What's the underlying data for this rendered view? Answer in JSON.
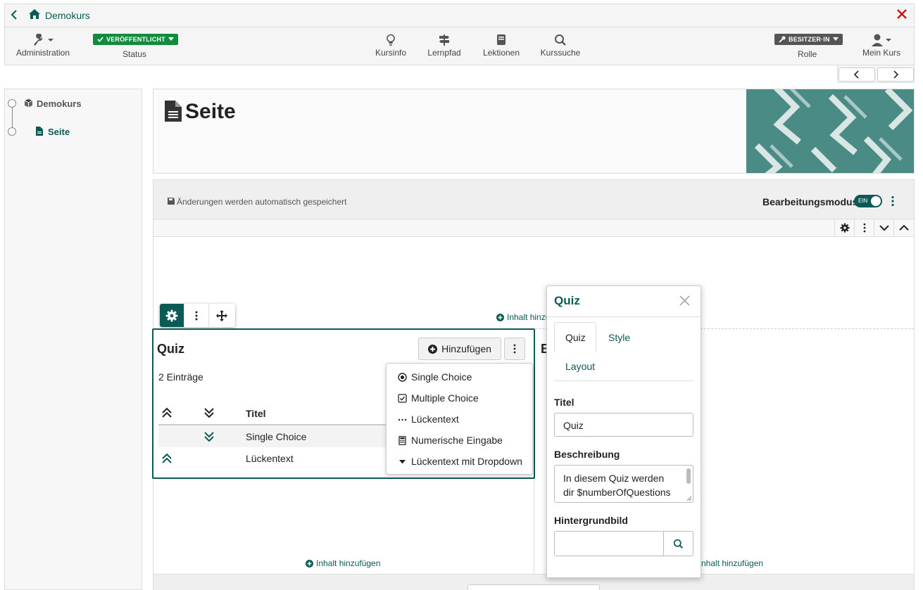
{
  "colors": {
    "accent": "#0b5a55",
    "published": "#118c3e",
    "danger": "#cc1111"
  },
  "breadcrumb": {
    "course": "Demokurs"
  },
  "toolbar": {
    "administration": "Administration",
    "status_badge": "VERÖFFENTLICHT",
    "status_label": "Status",
    "kursinfo": "Kursinfo",
    "lernpfad": "Lernpfad",
    "lektionen": "Lektionen",
    "kurssuche": "Kurssuche",
    "role_badge": "BESITZER·IN",
    "role_label": "Rolle",
    "my_course": "Mein Kurs"
  },
  "tree": {
    "root": "Demokurs",
    "child": "Seite"
  },
  "page": {
    "title": "Seite"
  },
  "editor": {
    "autosave": "Änderungen werden automatisch gespeichert",
    "mode_label": "Bearbeitungsmodus",
    "mode_toggle": "EIN",
    "add_content": "Inhalt hinzufügen",
    "add_content_partial": "Inhalt hinzu",
    "add_content_right": "nhalt hinzufügen"
  },
  "quiz": {
    "title": "Quiz",
    "add_button": "Hinzufügen",
    "count": "2 Einträge",
    "col_title": "Titel",
    "rows": [
      "Single Choice",
      "Lückentext"
    ],
    "peek_letter": "B"
  },
  "dropdown": {
    "items": [
      "Single Choice",
      "Multiple Choice",
      "Lückentext",
      "Numerische Eingabe",
      "Lückentext mit Dropdown"
    ]
  },
  "panel": {
    "title": "Quiz",
    "tabs": [
      "Quiz",
      "Style",
      "Layout"
    ],
    "title_label": "Titel",
    "title_value": "Quiz",
    "desc_label": "Beschreibung",
    "desc_line1": "In diesem Quiz werden",
    "desc_line2": "dir $numberOfQuestions",
    "bg_label": "Hintergrundbild"
  }
}
